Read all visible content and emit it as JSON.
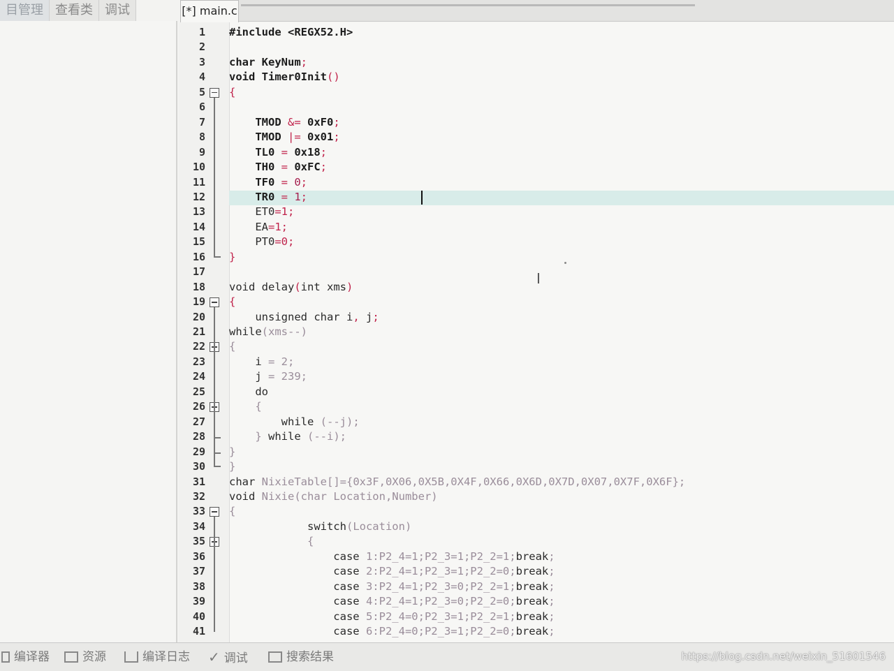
{
  "left_tabs": [
    "目管理",
    "查看类",
    "调试"
  ],
  "editor_tab": "[*] main.c",
  "code_lines": [
    {
      "n": "1",
      "segs": [
        [
          "kw",
          "#include <REGX52.H>"
        ]
      ]
    },
    {
      "n": "2",
      "segs": []
    },
    {
      "n": "3",
      "segs": [
        [
          "kw",
          "char KeyNum"
        ],
        [
          "op",
          ";"
        ]
      ]
    },
    {
      "n": "4",
      "segs": [
        [
          "kw",
          "void Timer0Init"
        ],
        [
          "op",
          "()"
        ]
      ]
    },
    {
      "n": "5",
      "segs": [
        [
          "op",
          "{"
        ]
      ]
    },
    {
      "n": "6",
      "segs": []
    },
    {
      "n": "7",
      "segs": [
        [
          "kw",
          "    TMOD "
        ],
        [
          "op",
          "&="
        ],
        [
          "kw",
          " 0xF0"
        ],
        [
          "op",
          ";"
        ]
      ]
    },
    {
      "n": "8",
      "segs": [
        [
          "kw",
          "    TMOD "
        ],
        [
          "op",
          "|="
        ],
        [
          "kw",
          " 0x01"
        ],
        [
          "op",
          ";"
        ]
      ]
    },
    {
      "n": "9",
      "segs": [
        [
          "kw",
          "    TL0 "
        ],
        [
          "op",
          "="
        ],
        [
          "kw",
          " 0x18"
        ],
        [
          "op",
          ";"
        ]
      ]
    },
    {
      "n": "10",
      "segs": [
        [
          "kw",
          "    TH0 "
        ],
        [
          "op",
          "="
        ],
        [
          "kw",
          " 0xFC"
        ],
        [
          "op",
          ";"
        ]
      ]
    },
    {
      "n": "11",
      "segs": [
        [
          "kw",
          "    TF0 "
        ],
        [
          "op",
          "="
        ],
        [
          "num",
          " 0"
        ],
        [
          "op",
          ";"
        ]
      ]
    },
    {
      "n": "12",
      "segs": [
        [
          "kw",
          "    TR0 "
        ],
        [
          "op",
          "="
        ],
        [
          "num",
          " 1"
        ],
        [
          "op",
          ";"
        ]
      ]
    },
    {
      "n": "13",
      "segs": [
        [
          "tx",
          "    ET0"
        ],
        [
          "op",
          "=1;"
        ]
      ]
    },
    {
      "n": "14",
      "segs": [
        [
          "tx",
          "    EA"
        ],
        [
          "op",
          "=1;"
        ]
      ]
    },
    {
      "n": "15",
      "segs": [
        [
          "tx",
          "    PT0"
        ],
        [
          "op",
          "=0;"
        ]
      ]
    },
    {
      "n": "16",
      "segs": [
        [
          "op",
          "}"
        ]
      ]
    },
    {
      "n": "17",
      "segs": []
    },
    {
      "n": "18",
      "segs": [
        [
          "tx",
          "void delay"
        ],
        [
          "op",
          "("
        ],
        [
          "tx",
          "int xms"
        ],
        [
          "op",
          ")"
        ]
      ]
    },
    {
      "n": "19",
      "segs": [
        [
          "op",
          "{"
        ]
      ]
    },
    {
      "n": "20",
      "segs": [
        [
          "tx",
          "    unsigned char i"
        ],
        [
          "op",
          ","
        ],
        [
          "tx",
          " j"
        ],
        [
          "op",
          ";"
        ]
      ]
    },
    {
      "n": "21",
      "segs": [
        [
          "tx",
          "while"
        ],
        [
          "dim",
          "(xms--)"
        ]
      ]
    },
    {
      "n": "22",
      "segs": [
        [
          "dim",
          "{"
        ]
      ]
    },
    {
      "n": "23",
      "segs": [
        [
          "tx",
          "    i "
        ],
        [
          "dim",
          "= 2;"
        ]
      ]
    },
    {
      "n": "24",
      "segs": [
        [
          "tx",
          "    j "
        ],
        [
          "dim",
          "= 239;"
        ]
      ]
    },
    {
      "n": "25",
      "segs": [
        [
          "tx",
          "    do"
        ]
      ]
    },
    {
      "n": "26",
      "segs": [
        [
          "dim",
          "    {"
        ]
      ]
    },
    {
      "n": "27",
      "segs": [
        [
          "tx",
          "        while "
        ],
        [
          "dim",
          "(--j);"
        ]
      ]
    },
    {
      "n": "28",
      "segs": [
        [
          "dim",
          "    } "
        ],
        [
          "tx",
          "while "
        ],
        [
          "dim",
          "(--i);"
        ]
      ]
    },
    {
      "n": "29",
      "segs": [
        [
          "dim",
          "}"
        ]
      ]
    },
    {
      "n": "30",
      "segs": [
        [
          "dim",
          "}"
        ]
      ]
    },
    {
      "n": "31",
      "segs": [
        [
          "tx",
          "char "
        ],
        [
          "dim",
          "NixieTable[]={0x3F,0X06,0X5B,0X4F,0X66,0X6D,0X7D,0X07,0X7F,0X6F};"
        ]
      ]
    },
    {
      "n": "32",
      "segs": [
        [
          "tx",
          "void "
        ],
        [
          "dim",
          "Nixie(char Location,Number)"
        ]
      ]
    },
    {
      "n": "33",
      "segs": [
        [
          "dim",
          "{"
        ]
      ]
    },
    {
      "n": "34",
      "segs": [
        [
          "tx",
          "            switch"
        ],
        [
          "dim",
          "(Location)"
        ]
      ]
    },
    {
      "n": "35",
      "segs": [
        [
          "dim",
          "            {"
        ]
      ]
    },
    {
      "n": "36",
      "segs": [
        [
          "tx",
          "                case "
        ],
        [
          "dim",
          "1:P2_4=1;P2_3=1;P2_2=1;"
        ],
        [
          "tx",
          "break"
        ],
        [
          "dim",
          ";"
        ]
      ]
    },
    {
      "n": "37",
      "segs": [
        [
          "tx",
          "                case "
        ],
        [
          "dim",
          "2:P2_4=1;P2_3=1;P2_2=0;"
        ],
        [
          "tx",
          "break"
        ],
        [
          "dim",
          ";"
        ]
      ]
    },
    {
      "n": "38",
      "segs": [
        [
          "tx",
          "                case "
        ],
        [
          "dim",
          "3:P2_4=1;P2_3=0;P2_2=1;"
        ],
        [
          "tx",
          "break"
        ],
        [
          "dim",
          ";"
        ]
      ]
    },
    {
      "n": "39",
      "segs": [
        [
          "tx",
          "                case "
        ],
        [
          "dim",
          "4:P2_4=1;P2_3=0;P2_2=0;"
        ],
        [
          "tx",
          "break"
        ],
        [
          "dim",
          ";"
        ]
      ]
    },
    {
      "n": "40",
      "segs": [
        [
          "tx",
          "                case "
        ],
        [
          "dim",
          "5:P2_4=0;P2_3=1;P2_2=1;"
        ],
        [
          "tx",
          "break"
        ],
        [
          "dim",
          ";"
        ]
      ]
    },
    {
      "n": "41",
      "segs": [
        [
          "tx",
          "                case "
        ],
        [
          "dim",
          "6:P2_4=0;P2_3=1;P2_2=0;"
        ],
        [
          "tx",
          "break"
        ],
        [
          "dim",
          ";"
        ]
      ]
    }
  ],
  "highlighted_line": "12",
  "fold_markers": [
    "5",
    "19",
    "22",
    "26",
    "33",
    "35"
  ],
  "fold_ends": [
    "16",
    "30"
  ],
  "fold_tees": [
    "28",
    "29"
  ],
  "bottom_tabs": [
    "编译器",
    "资源",
    "编译日志",
    "调试",
    "搜索结果"
  ],
  "bottom_icons": [
    "compiler-icon",
    "resources-icon",
    "chart-log-icon",
    "debug-check-icon",
    "search-results-icon"
  ],
  "watermark": "https://blog.csdn.net/weixin_51601546",
  "colors": {
    "keyword": "#1c1c1c",
    "operator": "#c0234b",
    "number": "#a51e4e",
    "highlight": "#d8ece9"
  }
}
